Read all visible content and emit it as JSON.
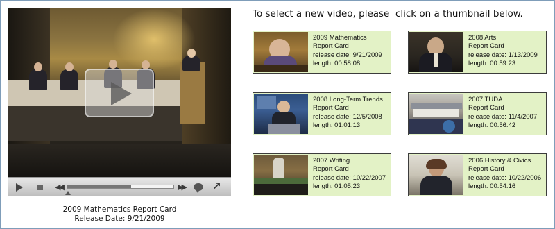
{
  "instruction": "To select a new video, please  click on a thumbnail below.",
  "player": {
    "caption_title": "2009 Mathematics Report Card",
    "caption_release": "Release Date: 9/21/2009",
    "progress": 0.6
  },
  "thumbnails": [
    {
      "title_line1": "2009 Mathematics",
      "title_line2": "Report Card",
      "release": "release date: 9/21/2009",
      "length": "length: 00:58:08"
    },
    {
      "title_line1": "2008 Arts",
      "title_line2": "Report Card",
      "release": "release date: 1/13/2009",
      "length": "length: 00:59:23"
    },
    {
      "title_line1": "2008 Long-Term Trends",
      "title_line2": "Report Card",
      "release": "release date: 12/5/2008",
      "length": "length: 01:01:13"
    },
    {
      "title_line1": "2007 TUDA",
      "title_line2": "Report Card",
      "release": "release date: 11/4/2007",
      "length": "length: 00:56:42"
    },
    {
      "title_line1": "2007 Writing",
      "title_line2": "Report Card",
      "release": "release date: 10/22/2007",
      "length": "length: 01:05:23"
    },
    {
      "title_line1": "2006 History & Civics",
      "title_line2": "Report Card",
      "release": "release date: 10/22/2006",
      "length": "length: 00:54:16"
    }
  ],
  "colors": {
    "thumb_bg": "#e3f2c6",
    "frame_border": "#7f9db9"
  },
  "icons": [
    "play-icon",
    "stop-icon",
    "rewind-icon",
    "fast-forward-icon",
    "captions-icon",
    "expand-icon"
  ]
}
